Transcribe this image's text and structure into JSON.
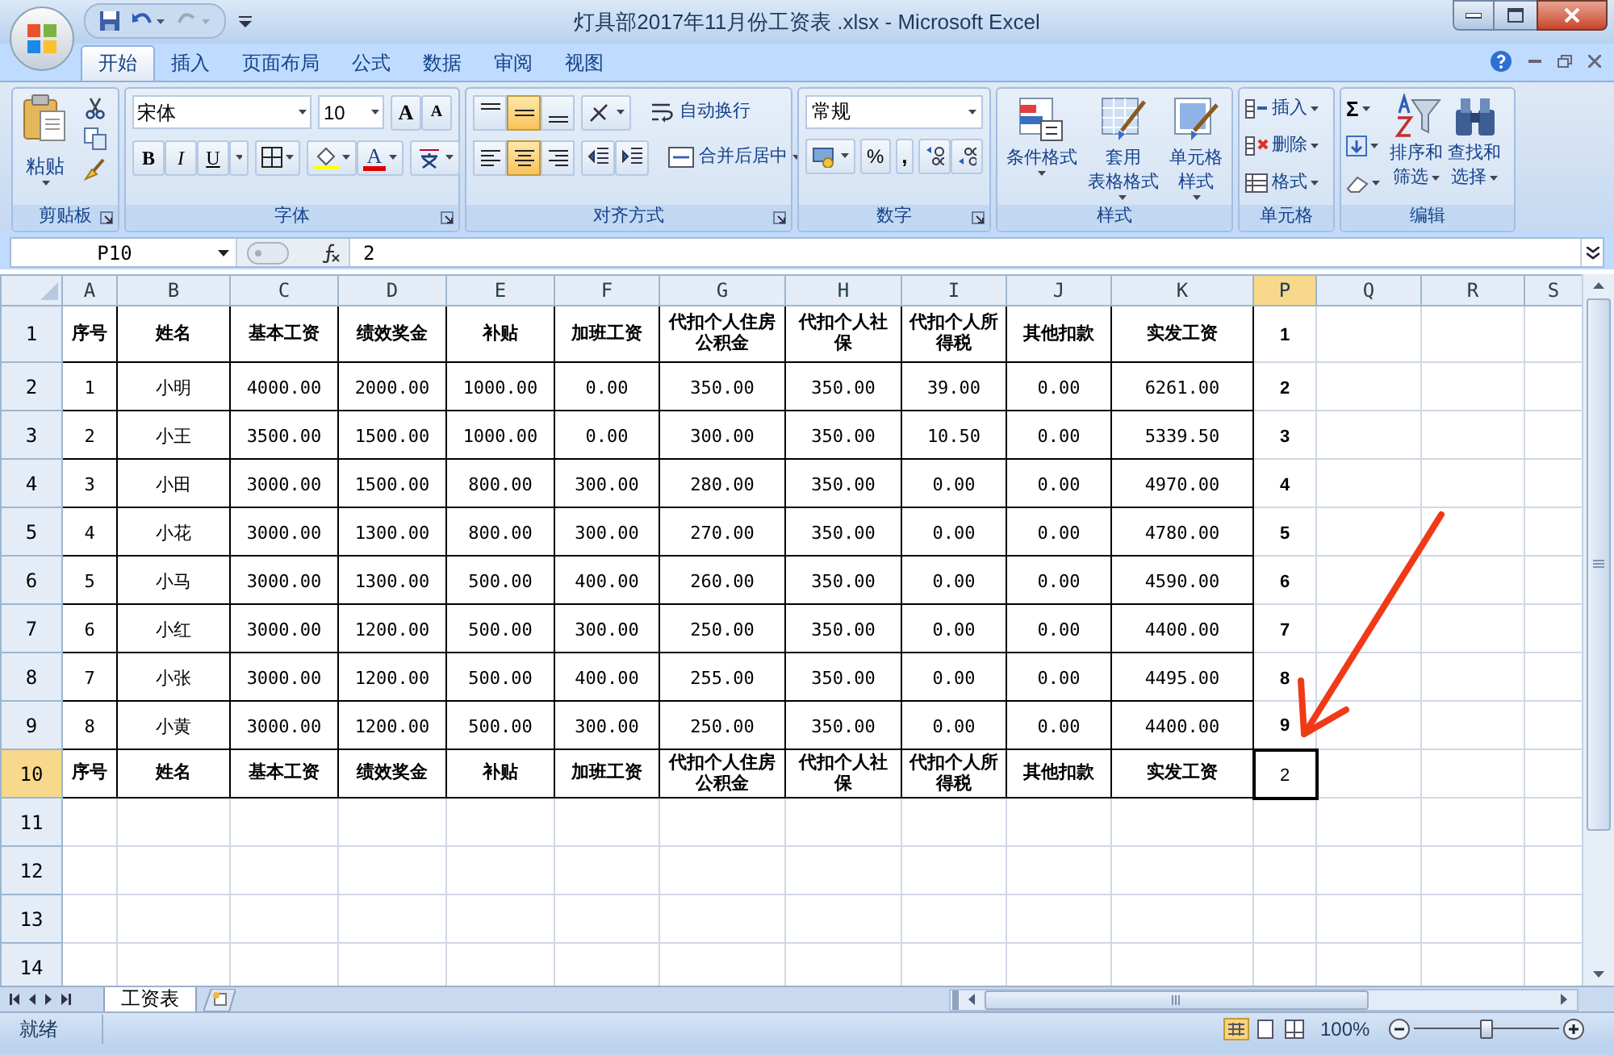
{
  "window": {
    "title": "灯具部2017年11月份工资表 .xlsx - Microsoft Excel"
  },
  "ribbon_tabs": [
    {
      "label": "开始",
      "selected": true
    },
    {
      "label": "插入",
      "selected": false
    },
    {
      "label": "页面布局",
      "selected": false
    },
    {
      "label": "公式",
      "selected": false
    },
    {
      "label": "数据",
      "selected": false
    },
    {
      "label": "审阅",
      "selected": false
    },
    {
      "label": "视图",
      "selected": false
    }
  ],
  "clipboard": {
    "label": "剪贴板",
    "paste": "粘贴"
  },
  "font": {
    "label": "字体",
    "font_name": "宋体",
    "font_size": "10",
    "size_buttons": [
      "A",
      "A"
    ],
    "format_buttons": [
      "B",
      "I",
      "U"
    ],
    "color_letter": "A"
  },
  "alignment": {
    "label": "对齐方式",
    "vertical_align": [
      {
        "selected": false
      },
      {
        "selected": true
      },
      {
        "selected": false
      }
    ],
    "horizontal_align": [
      {
        "selected": false
      },
      {
        "selected": true
      },
      {
        "selected": false
      }
    ],
    "wrap": "自动换行",
    "merge": "合并后居中"
  },
  "number": {
    "label": "数字",
    "format": "常规",
    "percent": "%",
    "comma": ","
  },
  "styles": {
    "label": "样式",
    "buttons": [
      {
        "lines": [
          "条件格式"
        ]
      },
      {
        "lines": [
          "套用",
          "表格格式"
        ]
      },
      {
        "lines": [
          "单元格",
          "样式"
        ]
      }
    ]
  },
  "cells_group": {
    "label": "单元格",
    "buttons": [
      "插入",
      "删除",
      "格式"
    ]
  },
  "editing": {
    "label": "编辑",
    "sigma": "Σ",
    "buttons": [
      {
        "lines": [
          "排序和",
          "筛选"
        ]
      },
      {
        "lines": [
          "查找和",
          "选择"
        ]
      }
    ]
  },
  "name_box": "P10",
  "formula": "2",
  "columns": [
    {
      "label": "A",
      "selected": false
    },
    {
      "label": "B",
      "selected": false
    },
    {
      "label": "C",
      "selected": false
    },
    {
      "label": "D",
      "selected": false
    },
    {
      "label": "E",
      "selected": false
    },
    {
      "label": "F",
      "selected": false
    },
    {
      "label": "G",
      "selected": false
    },
    {
      "label": "H",
      "selected": false
    },
    {
      "label": "I",
      "selected": false
    },
    {
      "label": "J",
      "selected": false
    },
    {
      "label": "K",
      "selected": false
    },
    {
      "label": "P",
      "selected": true
    },
    {
      "label": "Q",
      "selected": false
    },
    {
      "label": "R",
      "selected": false
    },
    {
      "label": "S",
      "selected": false
    }
  ],
  "rows": [
    {
      "header": "1",
      "selected": false,
      "kind": "title",
      "cells": [
        "序号",
        "姓名",
        "基本工资",
        "绩效奖金",
        "补贴",
        "加班工资",
        "代扣个人住房公积金",
        "代扣个人社保",
        "代扣个人所得税",
        "其他扣款",
        "实发工资"
      ],
      "p": {
        "text": "1",
        "bold": true
      }
    },
    {
      "header": "2",
      "selected": false,
      "kind": "data",
      "cells": [
        "1",
        "小明",
        "4000.00",
        "2000.00",
        "1000.00",
        "0.00",
        "350.00",
        "350.00",
        "39.00",
        "0.00",
        "6261.00"
      ],
      "p": {
        "text": "2",
        "bold": true
      }
    },
    {
      "header": "3",
      "selected": false,
      "kind": "data",
      "cells": [
        "2",
        "小王",
        "3500.00",
        "1500.00",
        "1000.00",
        "0.00",
        "300.00",
        "350.00",
        "10.50",
        "0.00",
        "5339.50"
      ],
      "p": {
        "text": "3",
        "bold": true
      }
    },
    {
      "header": "4",
      "selected": false,
      "kind": "data",
      "cells": [
        "3",
        "小田",
        "3000.00",
        "1500.00",
        "800.00",
        "300.00",
        "280.00",
        "350.00",
        "0.00",
        "0.00",
        "4970.00"
      ],
      "p": {
        "text": "4",
        "bold": true
      }
    },
    {
      "header": "5",
      "selected": false,
      "kind": "data",
      "cells": [
        "4",
        "小花",
        "3000.00",
        "1300.00",
        "800.00",
        "300.00",
        "270.00",
        "350.00",
        "0.00",
        "0.00",
        "4780.00"
      ],
      "p": {
        "text": "5",
        "bold": true
      }
    },
    {
      "header": "6",
      "selected": false,
      "kind": "data",
      "cells": [
        "5",
        "小马",
        "3000.00",
        "1300.00",
        "500.00",
        "400.00",
        "260.00",
        "350.00",
        "0.00",
        "0.00",
        "4590.00"
      ],
      "p": {
        "text": "6",
        "bold": true
      }
    },
    {
      "header": "7",
      "selected": false,
      "kind": "data",
      "cells": [
        "6",
        "小红",
        "3000.00",
        "1200.00",
        "500.00",
        "300.00",
        "250.00",
        "350.00",
        "0.00",
        "0.00",
        "4400.00"
      ],
      "p": {
        "text": "7",
        "bold": true
      }
    },
    {
      "header": "8",
      "selected": false,
      "kind": "data",
      "cells": [
        "7",
        "小张",
        "3000.00",
        "1200.00",
        "500.00",
        "400.00",
        "255.00",
        "350.00",
        "0.00",
        "0.00",
        "4495.00"
      ],
      "p": {
        "text": "8",
        "bold": true
      }
    },
    {
      "header": "9",
      "selected": false,
      "kind": "data",
      "cells": [
        "8",
        "小黄",
        "3000.00",
        "1200.00",
        "500.00",
        "300.00",
        "250.00",
        "350.00",
        "0.00",
        "0.00",
        "4400.00"
      ],
      "p": {
        "text": "9",
        "bold": true
      }
    },
    {
      "header": "10",
      "selected": true,
      "kind": "title",
      "cells": [
        "序号",
        "姓名",
        "基本工资",
        "绩效奖金",
        "补贴",
        "加班工资",
        "代扣个人住房公积金",
        "代扣个人社保",
        "代扣个人所得税",
        "其他扣款",
        "实发工资"
      ],
      "p": {
        "text": "2",
        "bold": false
      }
    },
    {
      "header": "11",
      "selected": false,
      "kind": "empty"
    },
    {
      "header": "12",
      "selected": false,
      "kind": "empty"
    },
    {
      "header": "13",
      "selected": false,
      "kind": "empty"
    },
    {
      "header": "14",
      "selected": false,
      "kind": "empty"
    }
  ],
  "sheet_tabs": [
    {
      "label": "工资表",
      "selected": true
    }
  ],
  "status": "就绪",
  "zoom": {
    "label": "100%",
    "level": 0.5
  }
}
